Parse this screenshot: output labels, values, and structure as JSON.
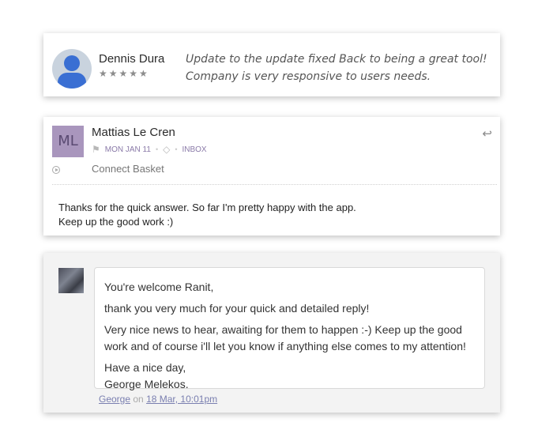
{
  "review": {
    "name": "Dennis Dura",
    "stars": "★★★★★",
    "line1": "Update to the update fixed Back to being a great tool!",
    "line2": "Company is very responsive to users needs."
  },
  "message": {
    "initials": "ML",
    "author": "Mattias Le Cren",
    "date": "MON JAN 11",
    "folder": "INBOX",
    "channel": "Connect Basket",
    "body_line1": "Thanks for the quick answer. So far I'm pretty happy with the app.",
    "body_line2": "Keep up the good work :)"
  },
  "comment": {
    "greeting": "You're welcome Ranit,",
    "p1": "thank you very much for your quick and detailed reply!",
    "p2": "Very nice news to hear, awaiting for them to happen :-) Keep up the good work and of course i'll let you know if anything else comes to my attention!",
    "sign1": "Have a nice day,",
    "sign2": "George Melekos.",
    "author_link": "George",
    "on": "on",
    "date_link": "18 Mar, 10:01pm"
  }
}
